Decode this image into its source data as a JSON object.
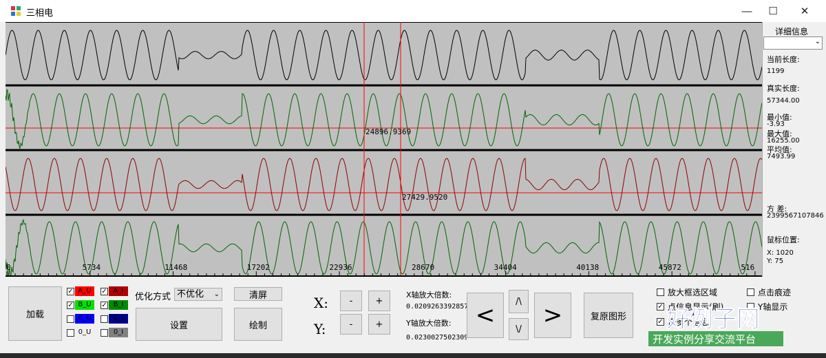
{
  "window": {
    "title": "三相电",
    "minimize": "—",
    "maximize": "☐",
    "close": "✕"
  },
  "axis": {
    "ticks": [
      "0",
      "5734",
      "11468",
      "17202",
      "22936",
      "28670",
      "34404",
      "40138",
      "45872",
      "516"
    ]
  },
  "plot": {
    "marker_b": "24896.9369",
    "marker_c": "27429.9520"
  },
  "info": {
    "header": "详细信息",
    "combo_value": "",
    "current_length_label": "当前长度:",
    "current_length": "1199",
    "real_length_label": "真实长度:",
    "real_length": "57344.00",
    "min_label": "最小值:",
    "min": "-3.93",
    "max_label": "最大值:",
    "max": "16255.00",
    "avg_label": "平均值:",
    "avg": "7493.99",
    "var_label": "方  差:",
    "var": "2399567107846",
    "mouse_label": "鼠标位置:",
    "mouse_x": "X:   1020",
    "mouse_y": "Y:   75"
  },
  "controls": {
    "load": "加载",
    "channels": [
      {
        "label": "A_U",
        "checked": true,
        "color": "#ff0000"
      },
      {
        "label": "A_I",
        "checked": true,
        "color": "#b00000"
      },
      {
        "label": "B_U",
        "checked": true,
        "color": "#00e000"
      },
      {
        "label": "B_I",
        "checked": true,
        "color": "#008a00"
      },
      {
        "label": "C_U",
        "checked": false,
        "color": "#0000ff"
      },
      {
        "label": "C_I",
        "checked": false,
        "color": "#00008b"
      },
      {
        "label": "0_U",
        "checked": false,
        "color": "#f0f0f0"
      },
      {
        "label": "0_I",
        "checked": false,
        "color": "#808080"
      }
    ],
    "optimize_label": "优化方式",
    "optimize_value": "不优化",
    "settings": "设置",
    "clear": "清屏",
    "draw": "绘制",
    "x_label": "X:",
    "y_label": "Y:",
    "minus": "-",
    "plus": "+",
    "x_zoom_label": "X轴放大倍数:",
    "x_zoom": "0.0209263392857",
    "y_zoom_label": "Y轴放大倍数:",
    "y_zoom": "0.0230027502309",
    "left": "<",
    "right": ">",
    "up": "/\\",
    "down": "\\/",
    "restore": "复原图形",
    "options": [
      {
        "label": "放大框选区域",
        "checked": false
      },
      {
        "label": "点击痕迹",
        "checked": false
      },
      {
        "label": "点信息显示(刷)",
        "checked": true
      },
      {
        "label": "Y轴显示",
        "checked": false
      },
      {
        "label": "诺多个信息",
        "checked": true
      },
      {
        "label": "放量显示",
        "checked": true
      }
    ]
  },
  "watermark": {
    "brand": "好例子网",
    "slogan": "开发实例分享交流平台"
  },
  "colors": {
    "plot_bg": "#c0c0c0",
    "trace_black": "#000000",
    "trace_green": "#006400",
    "trace_red": "#8b0000",
    "cursor": "#ff0000"
  }
}
